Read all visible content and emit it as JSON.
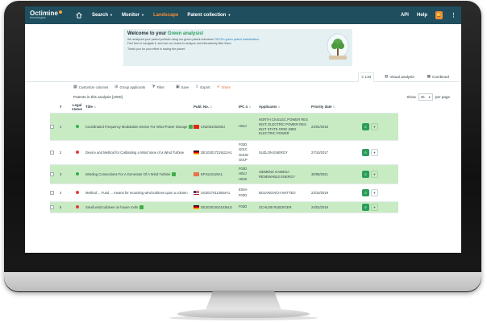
{
  "nav": {
    "logo_name": "Octimine",
    "logo_sub": "technologies",
    "items": [
      {
        "label": "Search",
        "has_menu": true,
        "active": false
      },
      {
        "label": "Monitor",
        "has_menu": true,
        "active": false
      },
      {
        "label": "Landscape",
        "has_menu": false,
        "active": true
      },
      {
        "label": "Patent collection",
        "has_menu": true,
        "active": false
      }
    ],
    "right": {
      "api": "API",
      "help": "Help"
    }
  },
  "banner": {
    "title_prefix": "Welcome to your ",
    "title_highlight": "Green analysis!",
    "line1_a": "We analyzed your patent portfolio using our green patent indicators ",
    "line1_link": "OECD's green patent classification",
    "line1_b": ".",
    "line2": "Feel free to navigate it, and use our charts to analyze and interactively filter them.",
    "line3": "Thank you for your effort in saving the planet."
  },
  "view_tabs": [
    {
      "label": "List",
      "active": true
    },
    {
      "label": "Visual analysis",
      "active": false
    },
    {
      "label": "Combined",
      "active": false
    }
  ],
  "toolbar": {
    "customize": "Customize columns",
    "group": "Group applicants",
    "filter": "Filter",
    "save": "Save",
    "export": "Export",
    "share": "Share"
  },
  "list": {
    "title": "Patents in this analysis [1000]",
    "show_label": "Show",
    "show_value": "25",
    "per_page": "per page"
  },
  "columns": {
    "number": "#",
    "legal_status": "Legal status",
    "title": "Title",
    "publ_no": "Publ. No.",
    "ipc": "IPC 4",
    "applicants": "Applicants",
    "priority_date": "Priority date"
  },
  "rows": [
    {
      "num": "1",
      "status": "green",
      "green": true,
      "title": "Coordinated Frequency Modulation Device For Wind Power Storage",
      "flag": "cn",
      "publ_no": "CN208100240U",
      "ipc": [
        "H02J"
      ],
      "applicants": [
        "NORTH CN ELEC POWER RES",
        "INST; ELECTRIC POWER RES",
        "INST STATE GRID JIBEI",
        "ELECTRIC POWER"
      ],
      "date": "23/04/2018"
    },
    {
      "num": "2",
      "status": "red",
      "green": false,
      "title": "Device and Method for Calibrating a Wind Vane of a Wind Turbine",
      "flag": "de",
      "publ_no": "DE102017219112A1",
      "ipc": [
        "F03D",
        "G01C",
        "G01W",
        "G01P"
      ],
      "applicants": [
        "SUZLON ENERGY"
      ],
      "date": "27/10/2017"
    },
    {
      "num": "3",
      "status": "green",
      "green": true,
      "title": "Winding Connections For A Generator Of A Wind Turbine",
      "flag": "ep2",
      "publ_no": "EP4142125A1",
      "ipc": [
        "F03D",
        "H02J",
        "H02K"
      ],
      "applicants": [
        "SIEMENS GAMESA",
        "RENEWABLE ENERGY"
      ],
      "date": "30/08/2021"
    },
    {
      "num": "4",
      "status": "red",
      "green": false,
      "title": "Method ... Fund ... means for mounting wind turbines upon a column",
      "flag": "us",
      "publ_no": "US20170114564A1",
      "ipc": [
        "E04H",
        "F03D"
      ],
      "applicants": [
        "BOJANOVICH MATTEO"
      ],
      "date": "23/10/2019"
    },
    {
      "num": "5",
      "status": "red",
      "green": true,
      "title": "Small wind turbines on house roofs",
      "flag": "de",
      "publ_no": "DE202019101036U1",
      "ipc": [
        "F03D"
      ],
      "applicants": [
        "SCHLOB RUEDIGER"
      ],
      "date": "24/02/2019"
    }
  ],
  "colors": {
    "nav_bg": "#1f4e5f",
    "active_nav": "#f28c38",
    "green_row": "#c9ebc4",
    "accent_green": "#2a9d5c"
  }
}
